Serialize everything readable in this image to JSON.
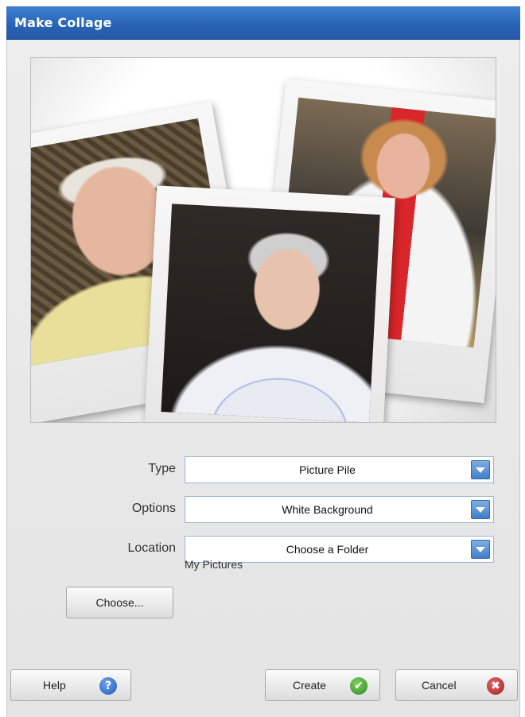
{
  "window": {
    "title": "Make Collage"
  },
  "preview": {
    "photos": [
      "photo-man",
      "photo-woman-center",
      "photo-woman-right"
    ]
  },
  "form": {
    "type": {
      "label": "Type",
      "value": "Picture Pile"
    },
    "options": {
      "label": "Options",
      "value": "White Background"
    },
    "location": {
      "label": "Location",
      "value": "Choose a Folder"
    },
    "choose_button": "Choose...",
    "folder_path": "My Pictures"
  },
  "footer": {
    "help_label": "Help",
    "create_label": "Create",
    "cancel_label": "Cancel",
    "help_icon": "?",
    "create_icon": "✔",
    "cancel_icon": "✖"
  },
  "colors": {
    "titlebar": "#2a63b4",
    "dropdown_arrow": "#3f7fc9",
    "help_icon": "#1f5bbd",
    "create_icon": "#2f8a2a",
    "cancel_icon": "#a41d1d"
  }
}
